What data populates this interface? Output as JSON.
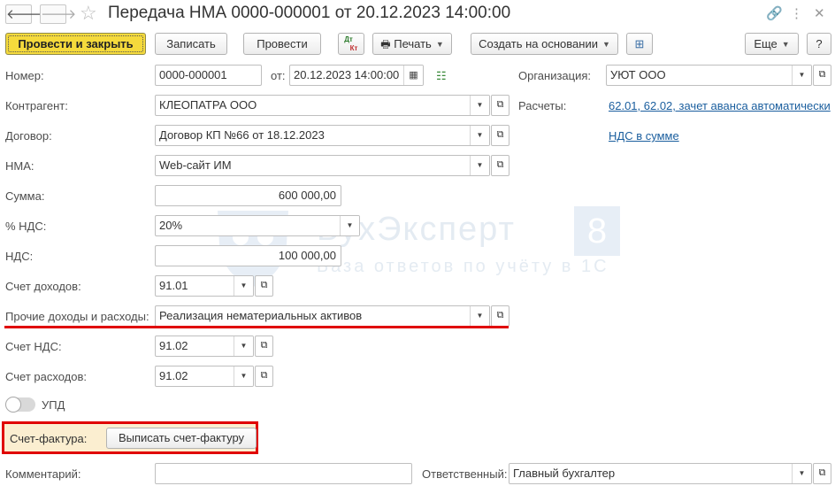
{
  "window": {
    "title": "Передача НМА 0000-000001 от 20.12.2023 14:00:00",
    "back_icon": "arrow-left-icon",
    "forward_icon": "arrow-right-icon",
    "favorite_icon": "star-icon"
  },
  "toolbar": {
    "post_close": "Провести и закрыть",
    "save": "Записать",
    "post": "Провести",
    "dtkt_top": "Дт",
    "dtkt_bottom": "Кт",
    "print": "Печать",
    "create_based": "Создать на основании",
    "more": "Еще",
    "help": "?"
  },
  "form": {
    "number_label": "Номер:",
    "number_value": "0000-000001",
    "date_label": "от:",
    "date_value": "20.12.2023 14:00:00",
    "org_label": "Организация:",
    "org_value": "УЮТ ООО",
    "counterparty_label": "Контрагент:",
    "counterparty_value": "КЛЕОПАТРА ООО",
    "settlements_label": "Расчеты:",
    "settlements_link": "62.01, 62.02, зачет аванса автоматически",
    "contract_label": "Договор:",
    "contract_value": "Договор КП №66 от 18.12.2023",
    "vat_link": "НДС в сумме",
    "nma_label": "НМА:",
    "nma_value": "Web-сайт ИМ",
    "sum_label": "Сумма:",
    "sum_value": "600 000,00",
    "vat_rate_label": "% НДС:",
    "vat_rate_value": "20%",
    "vat_label": "НДС:",
    "vat_value": "100 000,00",
    "income_account_label": "Счет доходов:",
    "income_account_value": "91.01",
    "other_income_label": "Прочие доходы и расходы:",
    "other_income_value": "Реализация нематериальных активов",
    "vat_account_label": "Счет НДС:",
    "vat_account_value": "91.02",
    "expense_account_label": "Счет расходов:",
    "expense_account_value": "91.02",
    "upd_label": "УПД",
    "invoice_label": "Счет-фактура:",
    "invoice_button": "Выписать счет-фактуру",
    "comment_label": "Комментарий:",
    "comment_value": "",
    "responsible_label": "Ответственный:",
    "responsible_value": "Главный бухгалтер"
  },
  "watermark": {
    "brand": "БухЭксперт",
    "brand_number": "8",
    "tagline": "База ответов по учёту в 1С"
  },
  "colors": {
    "primary_button": "#f5da3c",
    "link": "#1a5e9e",
    "highlight_red": "#e00000",
    "invoice_background": "#fbeed0"
  }
}
